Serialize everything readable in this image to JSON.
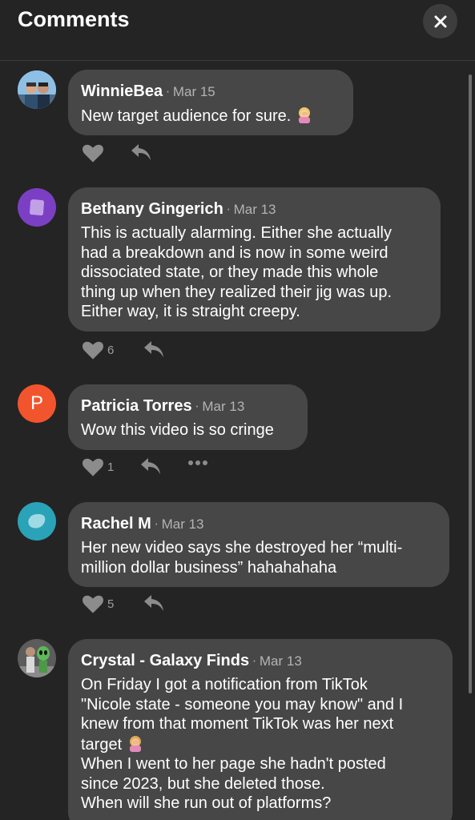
{
  "header": {
    "title": "Comments",
    "close_icon": "close-icon"
  },
  "comments": [
    {
      "author": "WinnieBea",
      "date": "Mar 15",
      "text": "New target audience for sure.",
      "likes": "",
      "avatar": "photo-couple"
    },
    {
      "author": "Bethany Gingerich",
      "date": "Mar 13",
      "text": "This is actually alarming. Either she actually\nhad a breakdown and is now in some weird\ndissociated state, or they made this whole\nthing up when they realized their jig was up.\nEither way, it is straight creepy.",
      "likes": "6",
      "avatar_color": "#7b3fc4"
    },
    {
      "author": "Patricia Torres",
      "date": "Mar 13",
      "text": "Wow this video is so cringe",
      "likes": "1",
      "avatar_letter": "P",
      "avatar_color": "#f2542d"
    },
    {
      "author": "Rachel M",
      "date": "Mar 13",
      "text": "Her new video says she destroyed her “multi-\nmillion dollar business” hahahahaha",
      "likes": "5",
      "avatar_color": "#2aa3b8"
    },
    {
      "author": "Crystal - Galaxy Finds",
      "date": "Mar 13",
      "text_line1": "On Friday I got a notification from TikTok\n\"Nicole state - someone you may know\" and I\nknew from that moment TikTok was her next\ntarget",
      "text_line2": "When I went to her page she hadn't posted\nsince 2023, but she deleted those.\nWhen will she run out of platforms?",
      "avatar": "photo-alien"
    }
  ]
}
